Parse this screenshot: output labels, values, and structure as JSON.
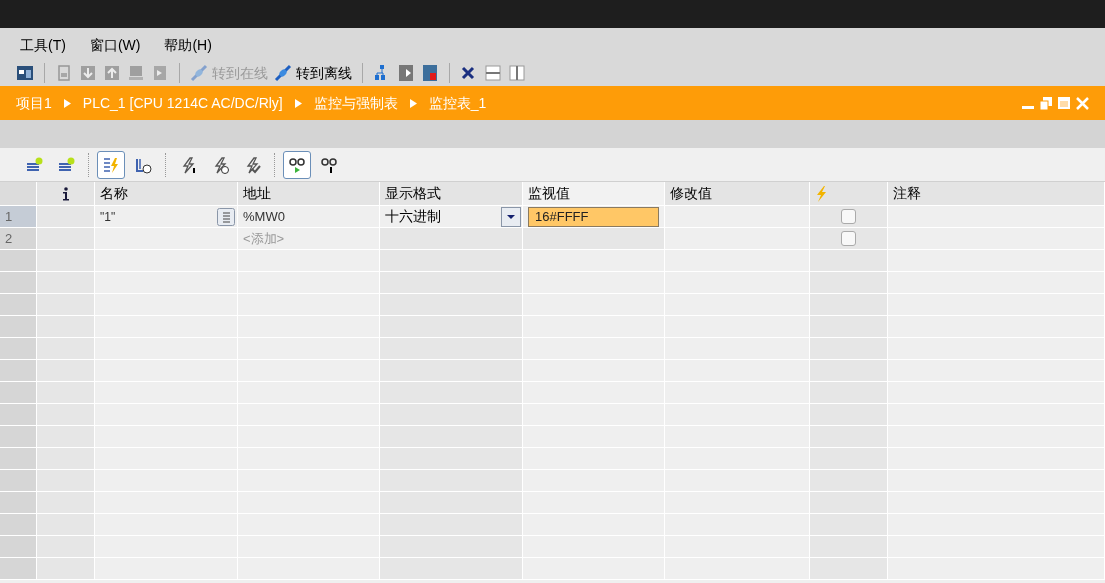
{
  "menu": [
    {
      "label": "工具(T)"
    },
    {
      "label": "窗口(W)"
    },
    {
      "label": "帮助(H)"
    }
  ],
  "toolbar": [
    {
      "kind": "icon",
      "disabled": false
    },
    {
      "kind": "separator"
    },
    {
      "kind": "icon",
      "disabled": true
    },
    {
      "kind": "icon",
      "disabled": true
    },
    {
      "kind": "icon",
      "disabled": true
    },
    {
      "kind": "icon",
      "disabled": true
    },
    {
      "kind": "icon",
      "disabled": true
    },
    {
      "kind": "separator"
    },
    {
      "kind": "text",
      "label": "转到在线",
      "disabled": true
    },
    {
      "kind": "text",
      "label": "转到离线",
      "disabled": false
    },
    {
      "kind": "separator"
    },
    {
      "kind": "icon",
      "disabled": false
    },
    {
      "kind": "icon",
      "disabled": false
    },
    {
      "kind": "icon",
      "disabled": false
    },
    {
      "kind": "separator"
    },
    {
      "kind": "icon",
      "disabled": false
    },
    {
      "kind": "icon",
      "disabled": false
    },
    {
      "kind": "icon",
      "disabled": false
    }
  ],
  "breadcrumb": [
    "项目1",
    "PLC_1 [CPU 1214C AC/DC/Rly]",
    "监控与强制表",
    "监控表_1"
  ],
  "table_toolbar": [
    {
      "kind": "icon",
      "selected": false
    },
    {
      "kind": "icon",
      "selected": false
    },
    {
      "kind": "separator"
    },
    {
      "kind": "icon",
      "selected": true
    },
    {
      "kind": "icon",
      "selected": false
    },
    {
      "kind": "separator"
    },
    {
      "kind": "icon",
      "selected": false
    },
    {
      "kind": "icon",
      "selected": false
    },
    {
      "kind": "icon",
      "selected": false
    },
    {
      "kind": "separator"
    },
    {
      "kind": "icon",
      "selected": true
    },
    {
      "kind": "icon",
      "selected": false
    }
  ],
  "table": {
    "columns": [
      {
        "kind": "info_icon"
      },
      {
        "kind": "text",
        "label": "名称"
      },
      {
        "kind": "text",
        "label": "地址"
      },
      {
        "kind": "text",
        "label": "显示格式"
      },
      {
        "kind": "text",
        "label": "监视值"
      },
      {
        "kind": "text",
        "label": "修改值"
      },
      {
        "kind": "force_icon"
      },
      {
        "kind": "text",
        "label": "注释"
      }
    ],
    "rows": [
      {
        "index": "1",
        "selected": true,
        "name": "\"1\"",
        "address": "%MW0",
        "address_placeholder": false,
        "format": "十六进制",
        "monitor_value": "16#FFFF",
        "monitor_highlight": true,
        "force_checked": false
      },
      {
        "index": "2",
        "selected": false,
        "address": "<添加>",
        "address_placeholder": true,
        "force_checked": false
      }
    ]
  }
}
